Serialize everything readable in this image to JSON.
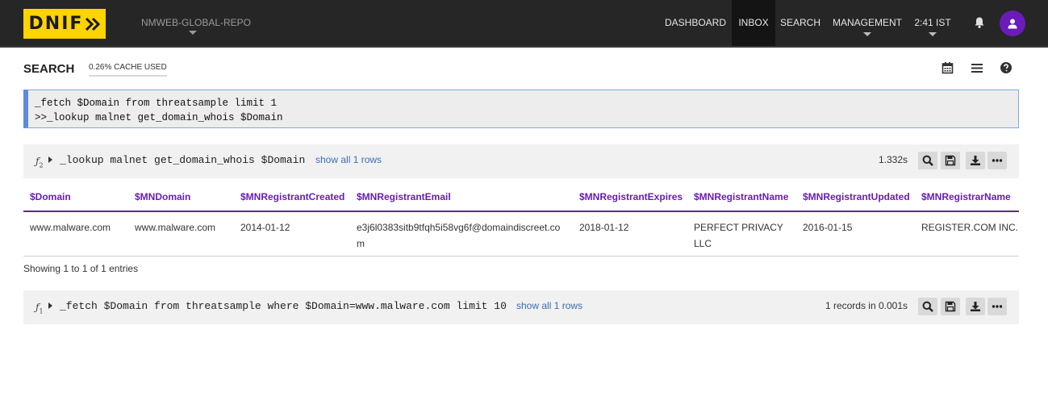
{
  "header": {
    "logo": "DNIF",
    "repo": "NMWEB-GLOBAL-REPO",
    "nav": [
      "DASHBOARD",
      "INBOX",
      "SEARCH",
      "MANAGEMENT",
      "2:41 IST"
    ],
    "active_nav": "INBOX",
    "icons": [
      "bell-icon",
      "user-icon"
    ]
  },
  "search": {
    "title": "SEARCH",
    "cache": "0.26% CACHE USED",
    "toolbar_icons": [
      "calendar-icon",
      "list-icon",
      "help-icon"
    ],
    "query_lines": [
      "_fetch $Domain from threatsample limit 1",
      ">>_lookup malnet get_domain_whois $Domain"
    ]
  },
  "results": [
    {
      "fn": "f2",
      "query": "_lookup malnet get_domain_whois $Domain",
      "show_all": "show all 1 rows",
      "timing": "1.332s",
      "columns": [
        "$Domain",
        "$MNDomain",
        "$MNRegistrantCreated",
        "$MNRegistrantEmail",
        "$MNRegistrantExpires",
        "$MNRegistrantName",
        "$MNRegistrantUpdated",
        "$MNRegistrarName"
      ],
      "rows": [
        [
          "www.malware.com",
          "www.malware.com",
          "2014-01-12",
          "e3j6l0383sitb9tfqh5i58vg6f@domaindiscreet.com",
          "2018-01-12",
          "PERFECT PRIVACY LLC",
          "2016-01-15",
          "REGISTER.COM INC."
        ]
      ],
      "entries": "Showing 1 to 1 of 1 entries"
    },
    {
      "fn": "f1",
      "query": "_fetch $Domain from threatsample where $Domain=www.malware.com limit 10",
      "show_all": "show all 1 rows",
      "timing": "1 records in 0.001s"
    }
  ],
  "result_actions": [
    "search-icon",
    "save-icon",
    "download-icon",
    "more-icon"
  ],
  "colors": {
    "topbar": "#262626",
    "logo": "#ffd400",
    "accent": "#6a1bb8",
    "link": "#3a6fb0",
    "query_border": "#5b8be0"
  }
}
